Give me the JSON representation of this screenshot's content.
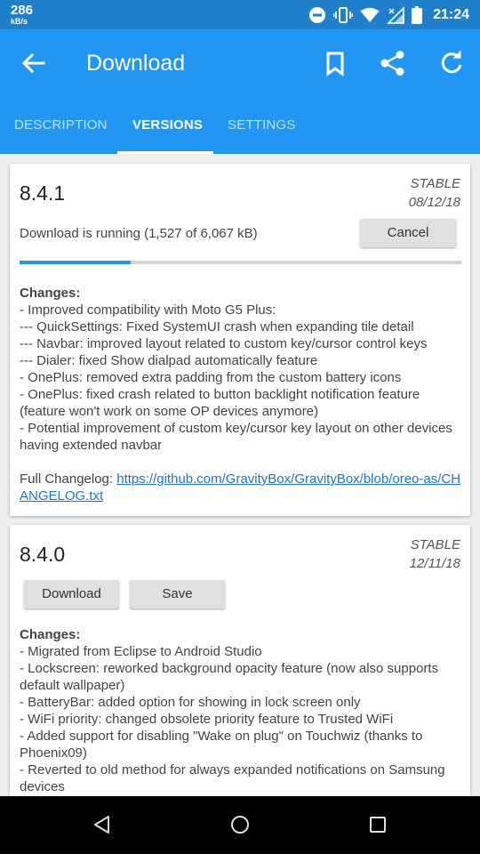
{
  "status_bar": {
    "speed_value": "286",
    "speed_unit": "kB/s",
    "time": "21:24",
    "icons": [
      "dnd-icon",
      "vibrate-icon",
      "wifi-icon",
      "signal-icon",
      "battery-icon"
    ]
  },
  "app_bar": {
    "title": "Download",
    "actions": [
      "back-icon",
      "bookmark-icon",
      "share-icon",
      "refresh-icon"
    ]
  },
  "tabs": [
    {
      "label": "DESCRIPTION",
      "active": false
    },
    {
      "label": "VERSIONS",
      "active": true
    },
    {
      "label": "SETTINGS",
      "active": false
    }
  ],
  "versions": [
    {
      "version": "8.4.1",
      "channel": "STABLE",
      "date": "08/12/18",
      "download_status": "Download is running (1,527 of 6,067 kB)",
      "download_progress": 0.252,
      "cancel_label": "Cancel",
      "changes_header": "Changes:",
      "changes": [
        "- Improved compatibility with Moto G5 Plus:",
        "--- QuickSettings: Fixed SystemUI crash when expanding tile detail",
        "--- Navbar: improved layout related to custom key/cursor control keys",
        "--- Dialer: fixed Show dialpad automatically feature",
        "- OnePlus: removed extra padding from the custom battery icons",
        "- OnePlus: fixed crash related to button backlight notification feature (feature won't work on some OP devices anymore)",
        "- Potential improvement of custom key/cursor key layout on other devices having extended navbar"
      ],
      "changelog_label": "Full Changelog: ",
      "changelog_url": "https://github.com/GravityBox/GravityBox/blob/oreo-as/CHANGELOG.txt"
    },
    {
      "version": "8.4.0",
      "channel": "STABLE",
      "date": "12/11/18",
      "download_label": "Download",
      "save_label": "Save",
      "changes_header": "Changes:",
      "changes": [
        "- Migrated from Eclipse to Android Studio",
        "- Lockscreen: reworked background opacity feature (now also supports default wallpaper)",
        "- BatteryBar: added option for showing in lock screen only",
        "- WiFi priority: changed obsolete priority feature to Trusted WiFi",
        "- Added support for disabling \"Wake on plug\" on Touchwiz (thanks to Phoenix09)",
        "- Reverted to old method for always expanded notifications on Samsung devices"
      ]
    }
  ],
  "nav_bar": [
    "nav-back-icon",
    "nav-home-icon",
    "nav-recents-icon"
  ],
  "colors": {
    "primary": "#2196F3",
    "primary_dark": "#1E7FCB",
    "link": "#1976D2"
  }
}
